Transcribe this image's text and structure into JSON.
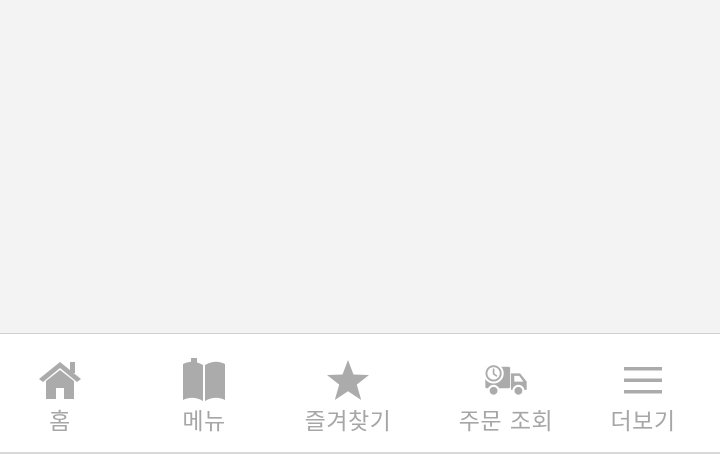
{
  "bottom_nav": {
    "colors": {
      "icon": "#ababab",
      "label": "#a6a6a6",
      "bar_background": "#ffffff",
      "page_background": "#f3f3f3"
    },
    "tabs": [
      {
        "id": "home",
        "label": "홈",
        "icon": "home-icon"
      },
      {
        "id": "menu",
        "label": "메뉴",
        "icon": "open-book-icon"
      },
      {
        "id": "favorites",
        "label": "즐겨찾기",
        "icon": "star-icon"
      },
      {
        "id": "order",
        "label": "주문 조회",
        "icon": "delivery-truck-clock-icon"
      },
      {
        "id": "more",
        "label": "더보기",
        "icon": "hamburger-menu-icon"
      }
    ]
  }
}
